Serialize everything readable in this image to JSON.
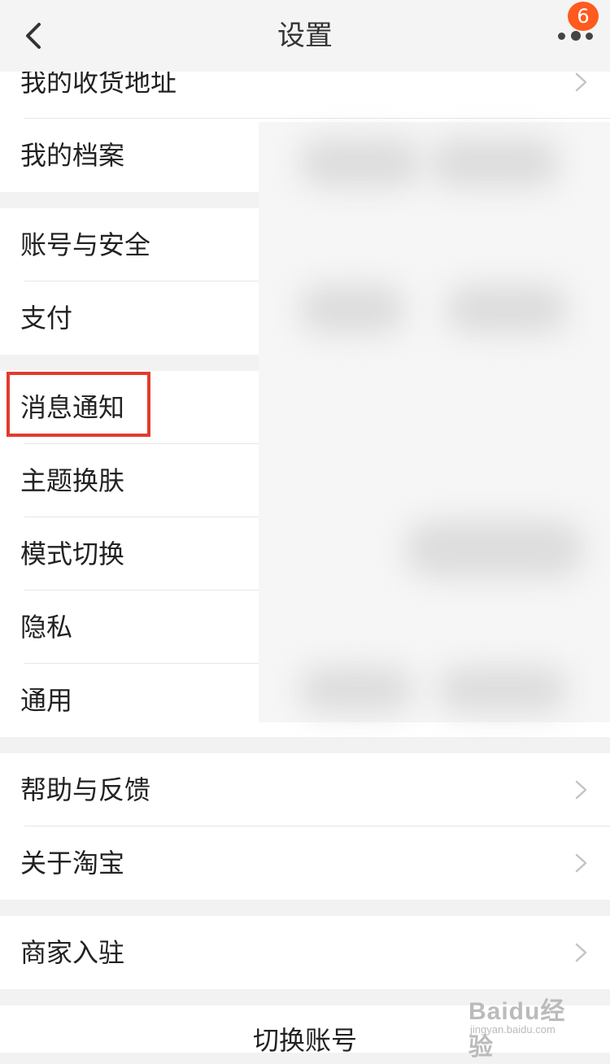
{
  "header": {
    "title": "设置",
    "notification_count": "6",
    "back_icon": "chevron-left-icon",
    "more_icon": "more-dots-icon"
  },
  "settings": [
    {
      "label": "我的收货地址",
      "has_chevron": true
    },
    {
      "label": "我的档案"
    },
    {
      "label": "账号与安全"
    },
    {
      "label": "支付"
    },
    {
      "label": "消息通知",
      "highlighted": true
    },
    {
      "label": "主题换肤"
    },
    {
      "label": "模式切换"
    },
    {
      "label": "隐私"
    },
    {
      "label": "通用"
    },
    {
      "label": "帮助与反馈",
      "has_chevron": true
    },
    {
      "label": "关于淘宝",
      "has_chevron": true
    },
    {
      "label": "商家入驻",
      "has_chevron": true
    }
  ],
  "footer": {
    "switch_account": "切换账号"
  },
  "watermark": {
    "brand": "Baidu经验",
    "url": "jingyan.baidu.com"
  },
  "colors": {
    "accent": "#ff5a1f",
    "highlight_border": "#e23b2e",
    "background": "#f2f2f2"
  }
}
